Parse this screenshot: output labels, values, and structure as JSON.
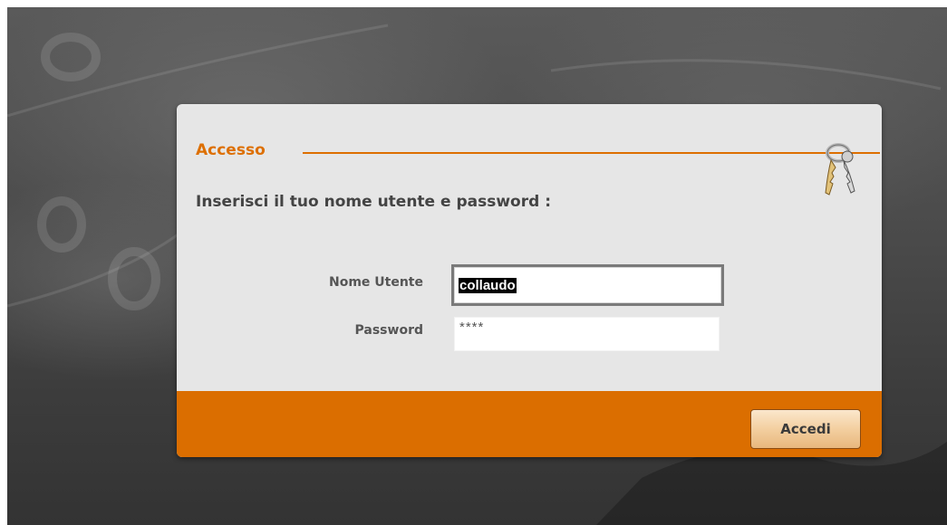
{
  "dialog": {
    "title": "Accesso",
    "instruction": "Inserisci il tuo nome utente e password :",
    "icon": "keys-icon"
  },
  "form": {
    "username_label": "Nome Utente",
    "username_value": "collaudo",
    "password_label": "Password",
    "password_value": "****"
  },
  "footer": {
    "login_button_label": "Accedi"
  },
  "colors": {
    "accent": "#dd6f00",
    "footer": "#db6e00",
    "dialog_bg": "#e6e6e6",
    "background": "#4a4a4a"
  }
}
